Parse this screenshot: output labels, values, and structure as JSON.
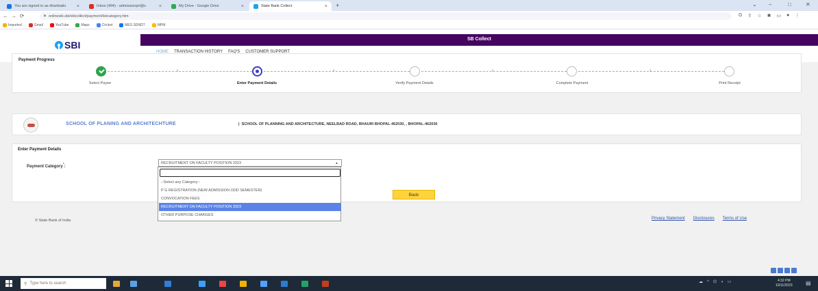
{
  "browser": {
    "tabs": [
      {
        "title": "You are signed in as dharibatio",
        "favicon_color": "#1a73e8"
      },
      {
        "title": "Inbox (494) - admissionpri@s",
        "favicon_color": "#d93025"
      },
      {
        "title": "My Drive - Google Drive",
        "favicon_color": "#34a853"
      },
      {
        "title": "State Bank Collect",
        "favicon_color": "#1da1f2"
      }
    ],
    "url": "onlinesbi.sbi/sbicollect/payment/listcategory.htm",
    "bookmarks": [
      {
        "label": "Imported",
        "color": "#f4b400"
      },
      {
        "label": "Gmail",
        "color": "#d93025"
      },
      {
        "label": "YouTube",
        "color": "#ff0000"
      },
      {
        "label": "Maps",
        "color": "#34a853"
      },
      {
        "label": "Cricket",
        "color": "#4285f4"
      },
      {
        "label": "MES SDNDT",
        "color": "#1a73e8"
      },
      {
        "label": "MPM",
        "color": "#fbbc04"
      }
    ]
  },
  "header": {
    "logo_text": "SBI",
    "title": "SB Collect",
    "nav": [
      "HOME",
      "TRANSACTION HISTORY",
      "FAQ'S",
      "CUSTOMER SUPPORT"
    ]
  },
  "progress": {
    "title": "Payment Progress",
    "steps": [
      {
        "label": "Select Payee",
        "state": "done"
      },
      {
        "label": "Enter Payment Details",
        "state": "current"
      },
      {
        "label": "Verify Payment Details",
        "state": "pending"
      },
      {
        "label": "Complete Payment",
        "state": "pending"
      },
      {
        "label": "Print Receipt",
        "state": "pending"
      }
    ]
  },
  "institution": {
    "name": "SCHOOL OF PLANING AND ARCHITECHTURE",
    "address": "SCHOOL OF PLANNING AND ARCHITECTURE, NEELBAD ROAD, BHAURI BHOPAL 462030, , BHOPAL-462030",
    "separator": "|"
  },
  "payment": {
    "section_title": "Enter Payment Details",
    "category_label": "Payment Category",
    "required_mark": "*",
    "selected_category": "RECRUITMENT ON FACULTY POSITION 2023",
    "search_value": "",
    "options": [
      "--Select any Category--",
      "P G REGISTRATION (NEW ADMISSION ODD SEMESTER)",
      "CONVOCATION FEES",
      "RECRUITMENT ON FACULTY POSITION 2023",
      "OTHER PURPOSE CHARGES"
    ],
    "selected_index": 3,
    "back_label": "Back"
  },
  "footer": {
    "copyright": "© State Bank of India",
    "links": [
      "Privacy Statement",
      "Disclosures",
      "Terms of Use"
    ]
  },
  "taskbar": {
    "search_placeholder": "Type here to search",
    "clock_time": "4:32 PM",
    "clock_date": "10/11/2023"
  },
  "colors": {
    "brand_purple": "#45045f",
    "step_done": "#2ea34a",
    "step_current": "#3d3dbf",
    "dropdown_selected": "#5b83e6",
    "back_button": "#ffd33d",
    "link": "#2b4fa8"
  }
}
